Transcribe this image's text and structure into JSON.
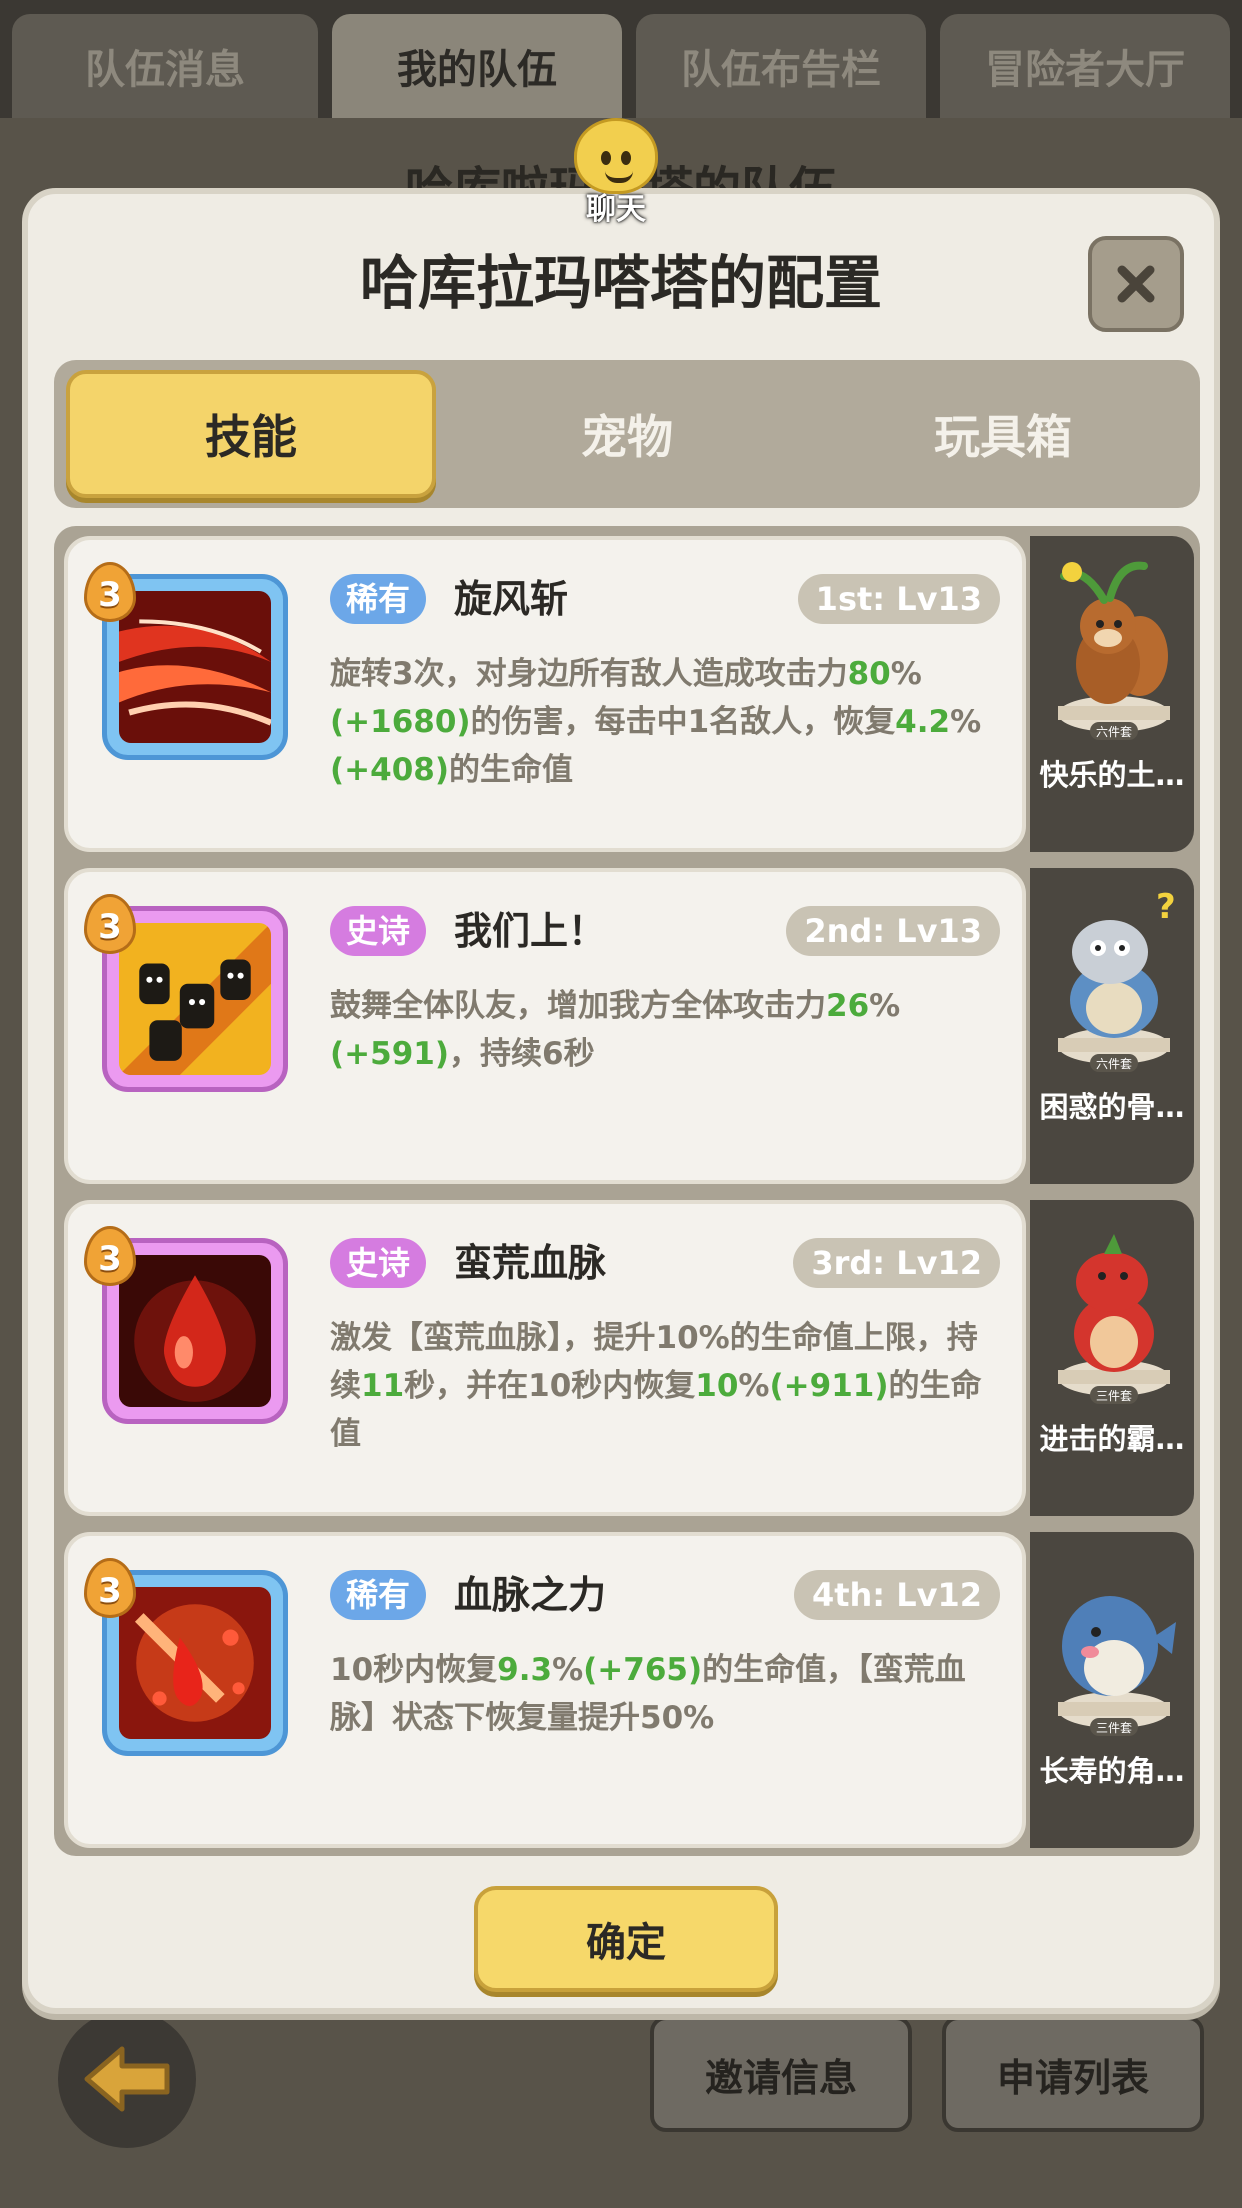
{
  "top_tabs": [
    "队伍消息",
    "我的队伍",
    "队伍布告栏",
    "冒险者大厅"
  ],
  "background_title": "哈库啦玛嗒塔的队伍",
  "chat": {
    "label": "聊天",
    "icon": "chat-smiley-icon"
  },
  "modal": {
    "title": "哈库拉玛嗒塔的配置",
    "close_icon": "close-icon",
    "tabs": [
      "技能",
      "宠物",
      "玩具箱"
    ],
    "active_tab": "技能",
    "confirm_label": "确定"
  },
  "skills": [
    {
      "level": "3",
      "rarity": "稀有",
      "rarity_type": "rare",
      "name": "旋风斩",
      "slot": "1st: Lv13",
      "desc_parts": [
        {
          "t": "旋转3次，对身边所有敌人造成攻击力"
        },
        {
          "t": "80",
          "g": true
        },
        {
          "t": "%"
        },
        {
          "t": "(+1680)",
          "g": true
        },
        {
          "t": "的伤害，每击中1名敌人，恢复"
        },
        {
          "t": "4.2",
          "g": true
        },
        {
          "t": "%"
        },
        {
          "t": "(+408)",
          "g": true
        },
        {
          "t": "的生命值"
        }
      ],
      "icon": "whirlwind-slash-icon",
      "pet": {
        "name": "快乐的土…",
        "set": "六件套",
        "icon": "squirrel-pet-icon"
      }
    },
    {
      "level": "3",
      "rarity": "史诗",
      "rarity_type": "epic",
      "name": "我们上！",
      "slot": "2nd: Lv13",
      "desc_parts": [
        {
          "t": "鼓舞全体队友，增加我方全体攻击力"
        },
        {
          "t": "26",
          "g": true
        },
        {
          "t": "%"
        },
        {
          "t": "(+591)",
          "g": true
        },
        {
          "t": "，持续6秒"
        }
      ],
      "icon": "rally-cheer-icon",
      "pet": {
        "name": "困惑的骨…",
        "set": "六件套",
        "icon": "dinosaur-pet-icon"
      }
    },
    {
      "level": "3",
      "rarity": "史诗",
      "rarity_type": "epic",
      "name": "蛮荒血脉",
      "slot": "3rd: Lv12",
      "desc_parts": [
        {
          "t": "激发【蛮荒血脉】，提升10%的生命值上限，持续"
        },
        {
          "t": "11",
          "g": true
        },
        {
          "t": "秒，并在10秒内恢复"
        },
        {
          "t": "10",
          "g": true
        },
        {
          "t": "%"
        },
        {
          "t": "(+911)",
          "g": true
        },
        {
          "t": "的生命值"
        }
      ],
      "icon": "blood-drop-icon",
      "pet": {
        "name": "进击的霸…",
        "set": "三件套",
        "icon": "red-dino-pet-icon"
      }
    },
    {
      "level": "3",
      "rarity": "稀有",
      "rarity_type": "rare",
      "name": "血脉之力",
      "slot": "4th: Lv12",
      "desc_parts": [
        {
          "t": "10秒内恢复"
        },
        {
          "t": "9.3",
          "g": true
        },
        {
          "t": "%"
        },
        {
          "t": "(+765)",
          "g": true
        },
        {
          "t": "的生命值，【蛮荒血脉】状态下恢复量提升50%"
        }
      ],
      "icon": "blood-power-icon",
      "pet": {
        "name": "长寿的角…",
        "set": "三件套",
        "icon": "whale-pet-icon"
      }
    }
  ],
  "bottom_buttons": [
    "邀请信息",
    "申请列表"
  ],
  "back_icon": "back-arrow-icon",
  "colors": {
    "accent_yellow": "#f4d46a",
    "rare_blue": "#6ca7e8",
    "epic_purple": "#d57ce0",
    "green_value": "#4cab3c"
  }
}
